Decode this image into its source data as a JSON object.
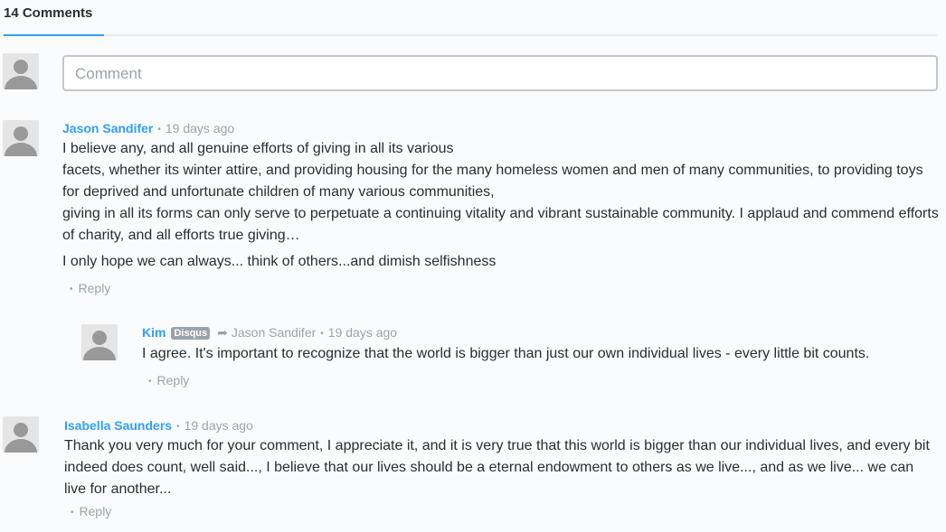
{
  "header": {
    "comment_count_label": "14 Comments"
  },
  "composer": {
    "placeholder": "Comment"
  },
  "posts": [
    {
      "author": "Jason Sandifer",
      "time": "19 days ago",
      "paragraphs": [
        "I believe any, and all genuine efforts of giving in all its various",
        "facets, whether its winter attire, and providing housing for the many homeless women and men of many communities, to providing toys for deprived and unfortunate children of many various communities,",
        "giving in all its forms can only serve to perpetuate a continuing vitality and vibrant sustainable community. I applaud and commend efforts of charity, and all efforts true giving…",
        "I only hope we can always... think of others...and dimish selfishness"
      ],
      "reply_label": "Reply"
    },
    {
      "author": "Kim",
      "badge": "Disqus",
      "in_reply_to": "Jason Sandifer",
      "time": "19 days ago",
      "paragraphs": [
        "I agree. It's important to recognize that the world is bigger than just our own individual lives - every little bit counts."
      ],
      "reply_label": "Reply"
    },
    {
      "author": "Isabella Saunders",
      "time": "19 days ago",
      "paragraphs": [
        "Thank you very much for your comment, I appreciate it, and it is very true that this world is bigger than our individual lives, and every bit indeed does count, well said..., I believe that our lives should be a eternal endowment to others as we live..., and as we live... we can live for another..."
      ],
      "reply_label": "Reply"
    }
  ]
}
